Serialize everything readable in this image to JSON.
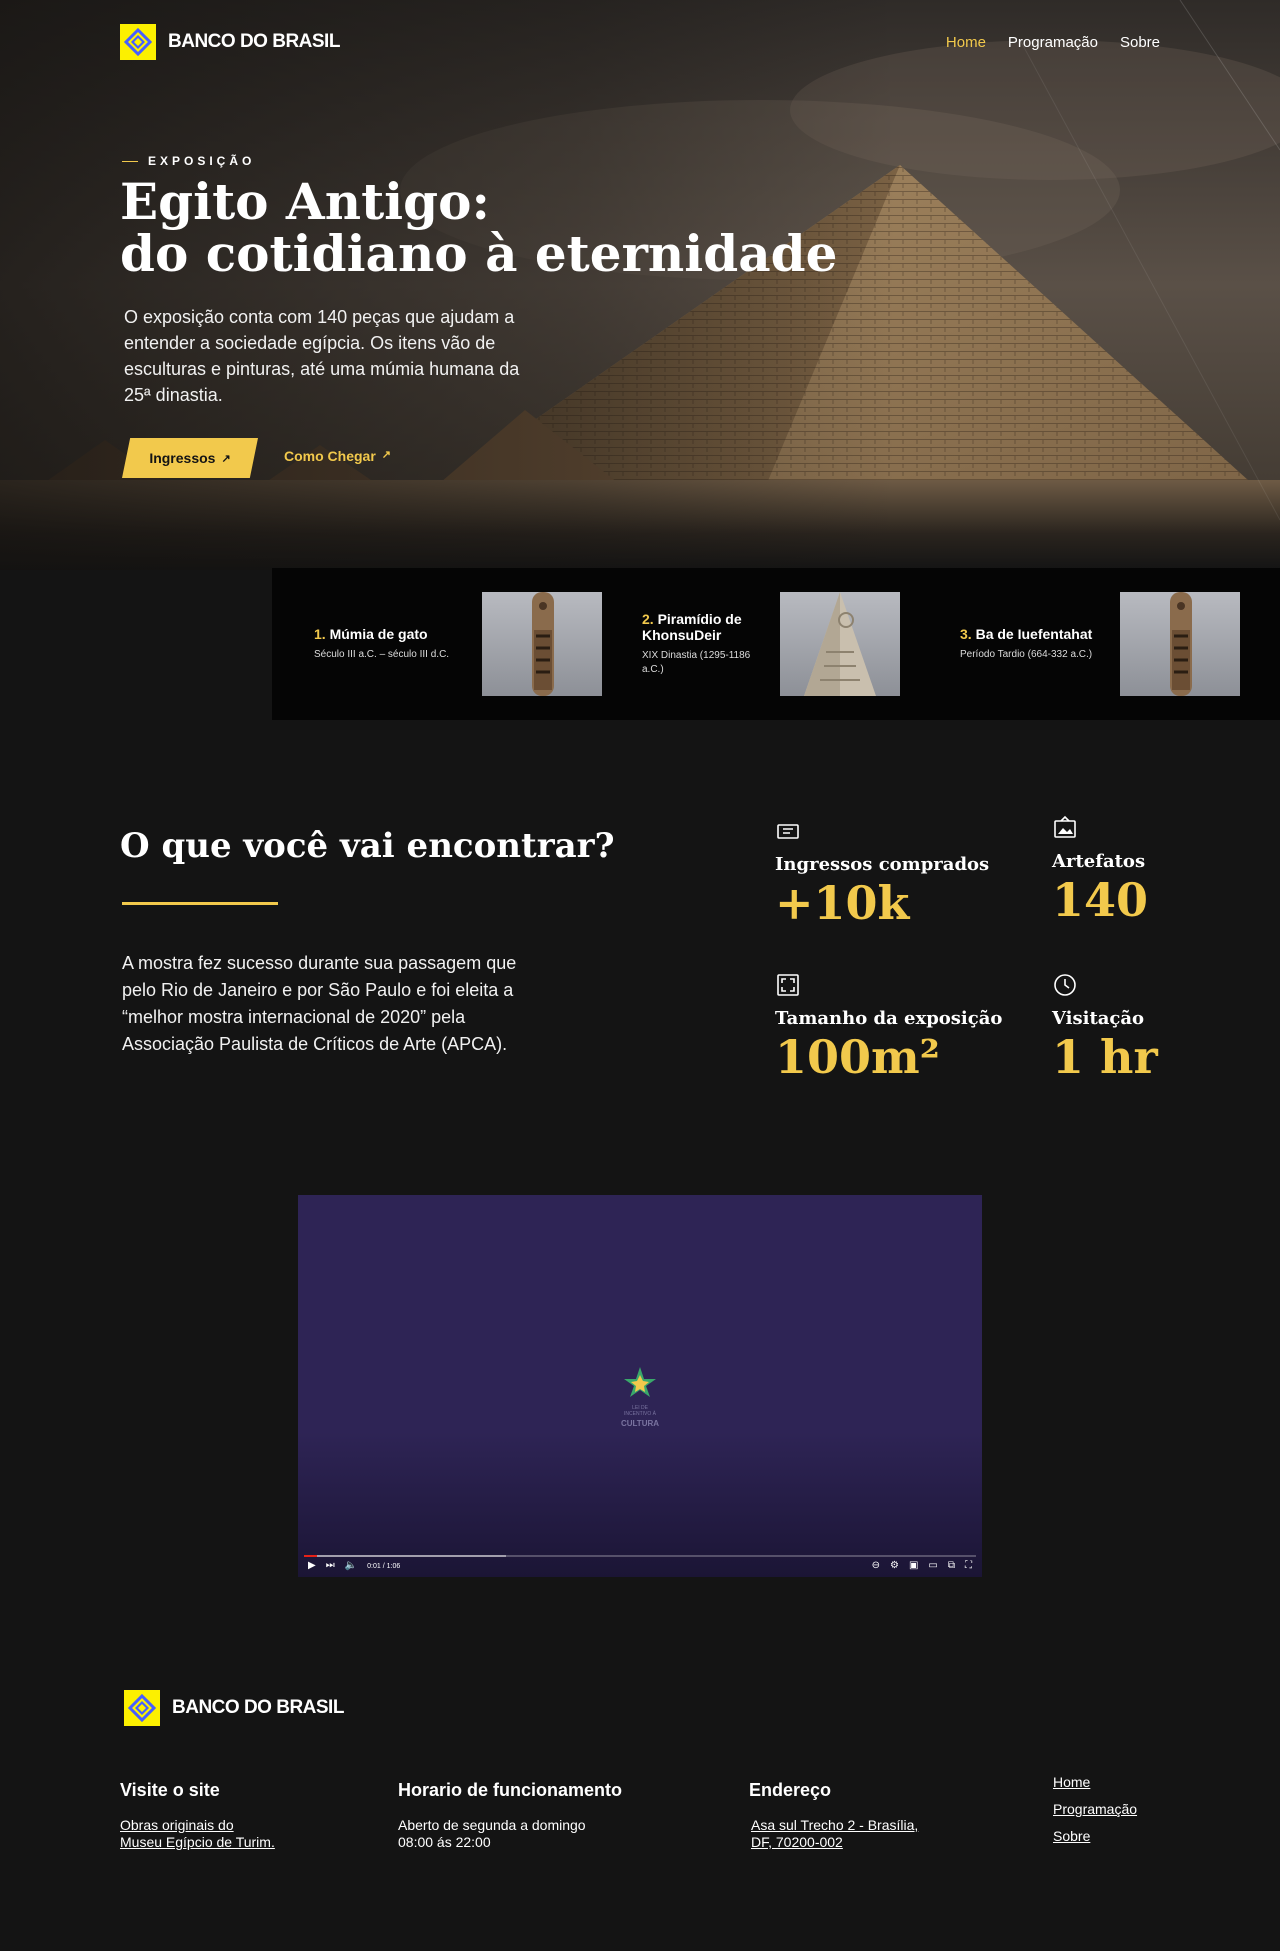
{
  "brand": {
    "name": "Banco do Brasil",
    "logo_text": "BANCO DO BRASIL",
    "logo_icon": "bb-logo-icon",
    "accent": "#f2c94c",
    "logo_yellow": "#fcf000",
    "logo_blue": "#465eff"
  },
  "nav": {
    "items": [
      {
        "label": "Home",
        "active": true
      },
      {
        "label": "Programação",
        "active": false
      },
      {
        "label": "Sobre",
        "active": false
      }
    ]
  },
  "hero": {
    "eyebrow": "EXPOSIÇÃO",
    "title_line1": "Egito Antigo:",
    "title_line2": "do cotidiano à eternidade",
    "description": "O exposição conta com 140 peças que ajudam a entender a sociedade egípcia. Os itens vão de esculturas e pinturas, até uma múmia humana da 25ª dinastia.",
    "primary_button": "Ingressos",
    "secondary_button": "Como Chegar"
  },
  "cards": [
    {
      "number": "1.",
      "title": "Múmia de gato",
      "subtitle": "Século III a.C. – século III d.C."
    },
    {
      "number": "2.",
      "title": "Piramídio de KhonsuDeir",
      "subtitle": "XIX Dinastia (1295-1186 a.C.)"
    },
    {
      "number": "3.",
      "title": "Ba de Iuefentahat",
      "subtitle": "Período Tardio (664-332 a.C.)"
    }
  ],
  "info": {
    "title": "O que você vai encontrar?",
    "text": "A mostra fez sucesso durante sua passagem que pelo Rio de Janeiro e por São Paulo e foi eleita a “melhor mostra internacional de 2020” pela Associação Paulista de Críticos de Arte (APCA)."
  },
  "stats": [
    {
      "icon": "ticket-icon",
      "label": "Ingressos comprados",
      "value": "+10k"
    },
    {
      "icon": "image-frame-icon",
      "label": "Artefatos",
      "value": "140"
    },
    {
      "icon": "expand-icon",
      "label": "Tamanho da exposição",
      "value": "100m²"
    },
    {
      "icon": "clock-icon",
      "label": "Visitação",
      "value": "1 hr"
    }
  ],
  "video": {
    "logo_text_small": "LEI DE INCENTIVO À",
    "logo_text": "CULTURA",
    "time": "0:01 / 1:06",
    "progress_played": 0.02,
    "progress_buffered": 0.3
  },
  "footer": {
    "visit": {
      "heading": "Visite o site",
      "link_line1": "Obras originais do",
      "link_line2": "Museu Egípcio de Turim."
    },
    "hours": {
      "heading": "Horario de funcionamento",
      "line1": "Aberto de segunda a domingo",
      "line2": "08:00 ás 22:00"
    },
    "address": {
      "heading": "Endereço",
      "line1": "Asa sul Trecho 2 - Brasília,",
      "line2": "DF, 70200-002"
    },
    "nav": [
      "Home",
      "Programação",
      "Sobre"
    ]
  }
}
